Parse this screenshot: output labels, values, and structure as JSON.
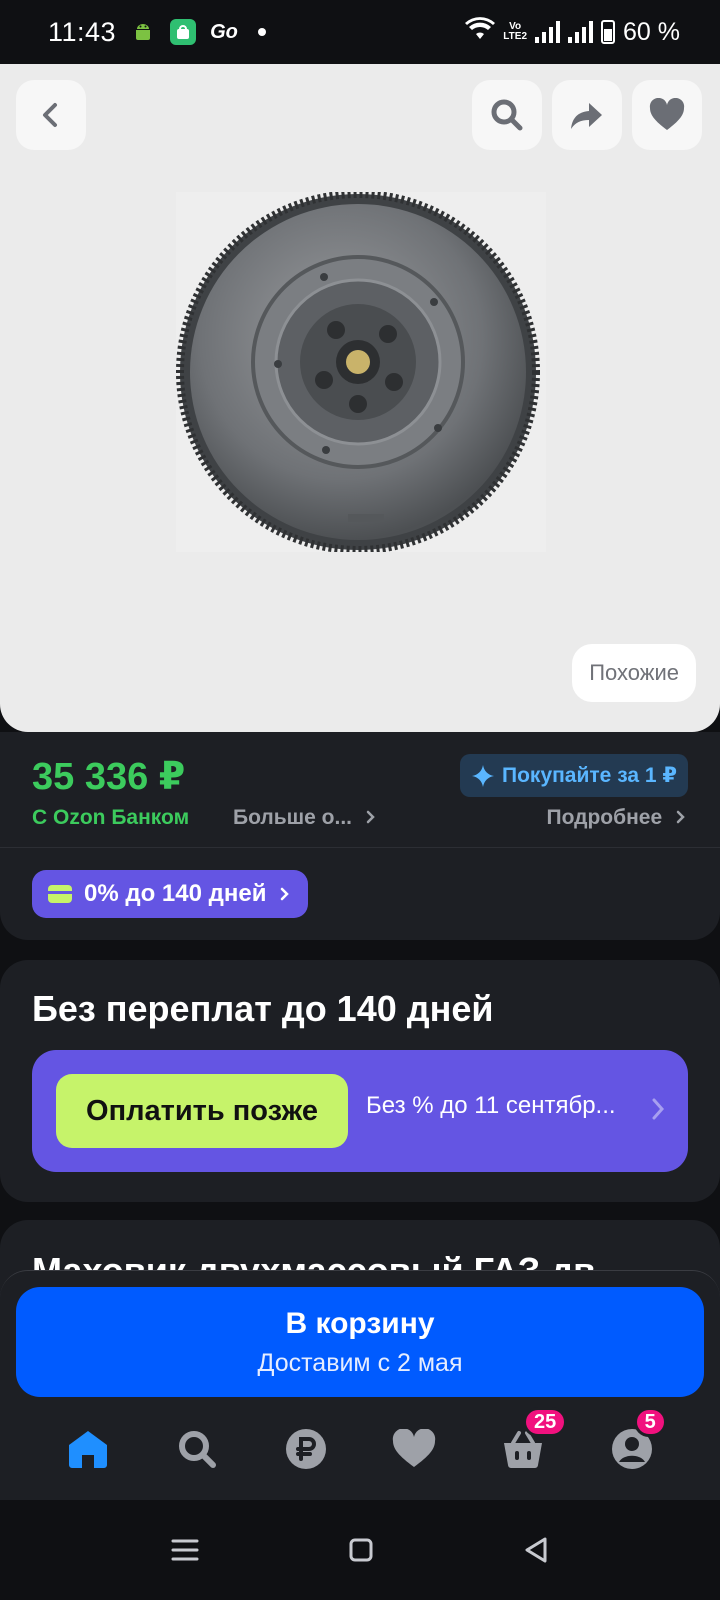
{
  "status_bar": {
    "time": "11:43",
    "battery": "60 %",
    "go_label": "Go"
  },
  "hero": {
    "similar_label": "Похожие",
    "image_alt": "Маховик"
  },
  "price_card": {
    "price": "35 336 ₽",
    "bank_label": "С Ozon Банком",
    "more_label": "Больше о...",
    "promo_label": "Покупайте за 1 ₽",
    "details_label": "Подробнее",
    "installment_label": "0% до 140 дней"
  },
  "pay_card": {
    "title": "Без переплат до 140 дней",
    "button_label": "Оплатить позже",
    "note": "Без % до 11 сентябр..."
  },
  "product": {
    "title": "Маховик двухмассовый ГАЗ дв"
  },
  "cart": {
    "main_label": "В корзину",
    "delivery_label": "Доставим с 2 мая"
  },
  "tabbar": {
    "cart_badge": "25",
    "profile_badge": "5"
  },
  "colors": {
    "accent": "#005bff",
    "price_green": "#3ccb5d",
    "purple": "#6455e3",
    "lime": "#c6f36a",
    "badge_pink": "#f1117e"
  }
}
